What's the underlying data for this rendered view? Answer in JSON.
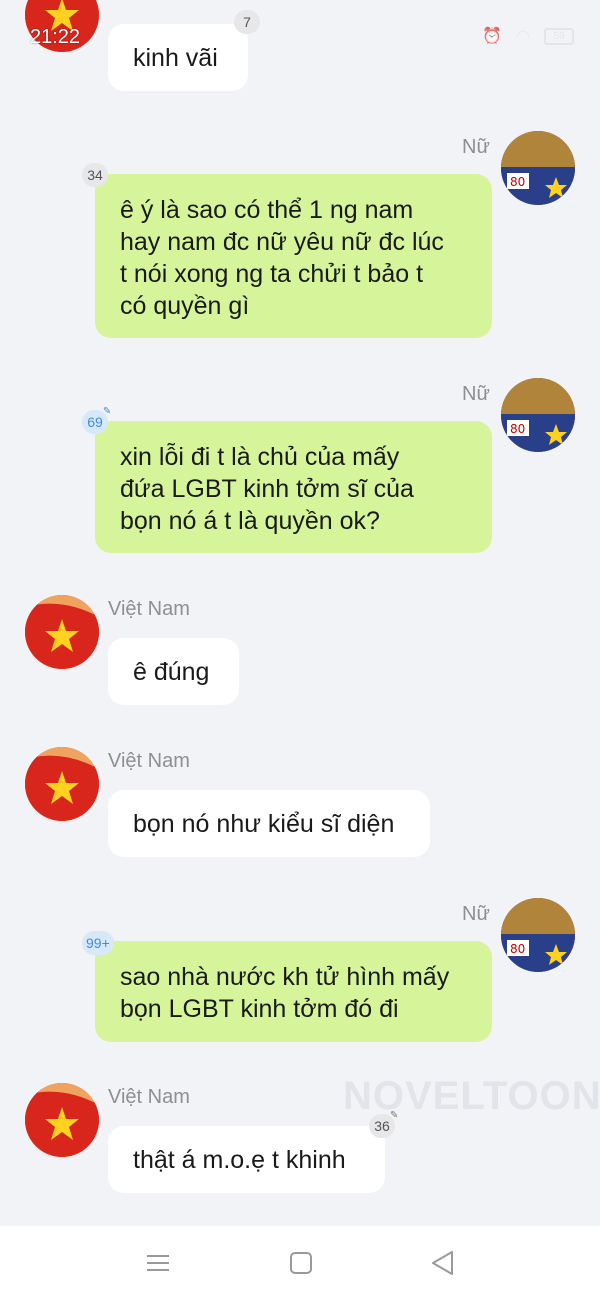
{
  "status_bar": {
    "time": "21:22",
    "battery": "59"
  },
  "watermark": "NOVELTOON",
  "messages": [
    {
      "sender": "Việt Nam",
      "text": "kinh vãi",
      "badge": "7",
      "side": "left"
    },
    {
      "sender": "Nữ",
      "text": "ê ý là sao có thể 1 ng nam\nhay nam đc nữ yêu nữ đc lúc\nt nói xong ng ta chửi t bảo t\ncó quyền gì",
      "badge": "34",
      "side": "right"
    },
    {
      "sender": "Nữ",
      "text": "xin lỗi đi t là chủ của mấy\nđứa LGBT kinh tởm sĩ của\nbọn nó á t là quyền ok?",
      "badge": "69",
      "side": "right"
    },
    {
      "sender": "Việt Nam",
      "text": "ê đúng",
      "side": "left"
    },
    {
      "sender": "Việt Nam",
      "text": "bọn nó như kiểu sĩ diện",
      "side": "left"
    },
    {
      "sender": "Nữ",
      "text": "sao nhà nước kh tử hình mấy\nbọn LGBT kinh tởm đó đi",
      "badge": "99+",
      "side": "right"
    },
    {
      "sender": "Việt Nam",
      "text": "thật á m.o.ẹ t khinh",
      "badge": "36",
      "side": "left"
    }
  ],
  "icons": {
    "nav": [
      "menu-icon",
      "home-square-icon",
      "back-triangle-icon"
    ]
  },
  "colors": {
    "right_bubble": "#d6f59a",
    "left_bubble": "#ffffff",
    "background": "#f2f3f7"
  }
}
